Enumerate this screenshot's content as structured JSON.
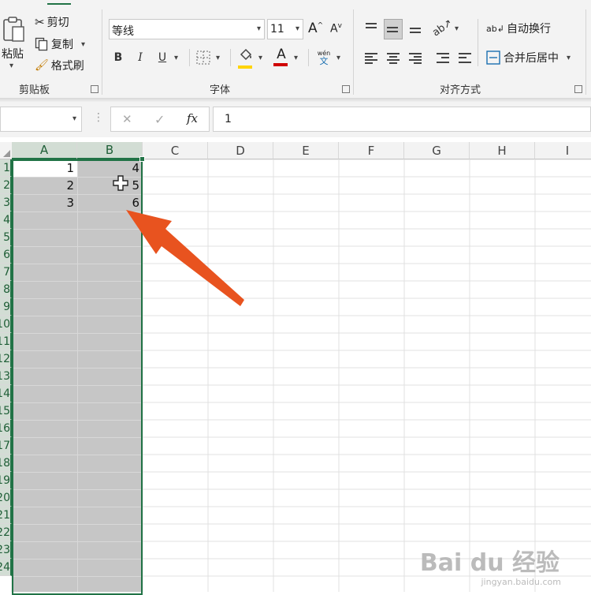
{
  "clipboard": {
    "paste_label": "粘贴",
    "cut_label": "剪切",
    "copy_label": "复制",
    "format_painter_label": "格式刷",
    "group_label": "剪贴板"
  },
  "font": {
    "font_name": "等线",
    "font_size": "11",
    "grow_label": "A",
    "shrink_label": "A",
    "bold": "B",
    "italic": "I",
    "underline": "U",
    "font_color_glyph": "A",
    "phonetic_top": "wén",
    "phonetic_bottom": "文",
    "group_label": "字体",
    "highlight_color": "#ffd400",
    "font_color": "#d00000"
  },
  "alignment": {
    "wrap_text_label": "自动换行",
    "merge_center_label": "合并后居中",
    "group_label": "对齐方式"
  },
  "formula_bar": {
    "name_box": "",
    "cancel_glyph": "✕",
    "enter_glyph": "✓",
    "fx_label": "fx",
    "content": "1"
  },
  "sheet": {
    "columns": [
      "A",
      "B",
      "C",
      "D",
      "E",
      "F",
      "G",
      "H",
      "I"
    ],
    "selected_columns": [
      "A",
      "B"
    ],
    "rows": [
      "1",
      "2",
      "3",
      "4",
      "5",
      "6",
      "7",
      "8",
      "9",
      "10",
      "11",
      "12",
      "13",
      "14",
      "15",
      "16",
      "17",
      "18",
      "19",
      "20",
      "21",
      "22",
      "23",
      "24"
    ],
    "col_a_values": [
      "1",
      "2",
      "3"
    ],
    "col_b_values": [
      "4",
      "5",
      "6"
    ],
    "accent": "#217346",
    "selection_fill": "#c6c6c6",
    "annotation_arrow_color": "#e8531f"
  },
  "watermark": {
    "brand": "Bai du 经验",
    "url": "jingyan.baidu.com"
  }
}
